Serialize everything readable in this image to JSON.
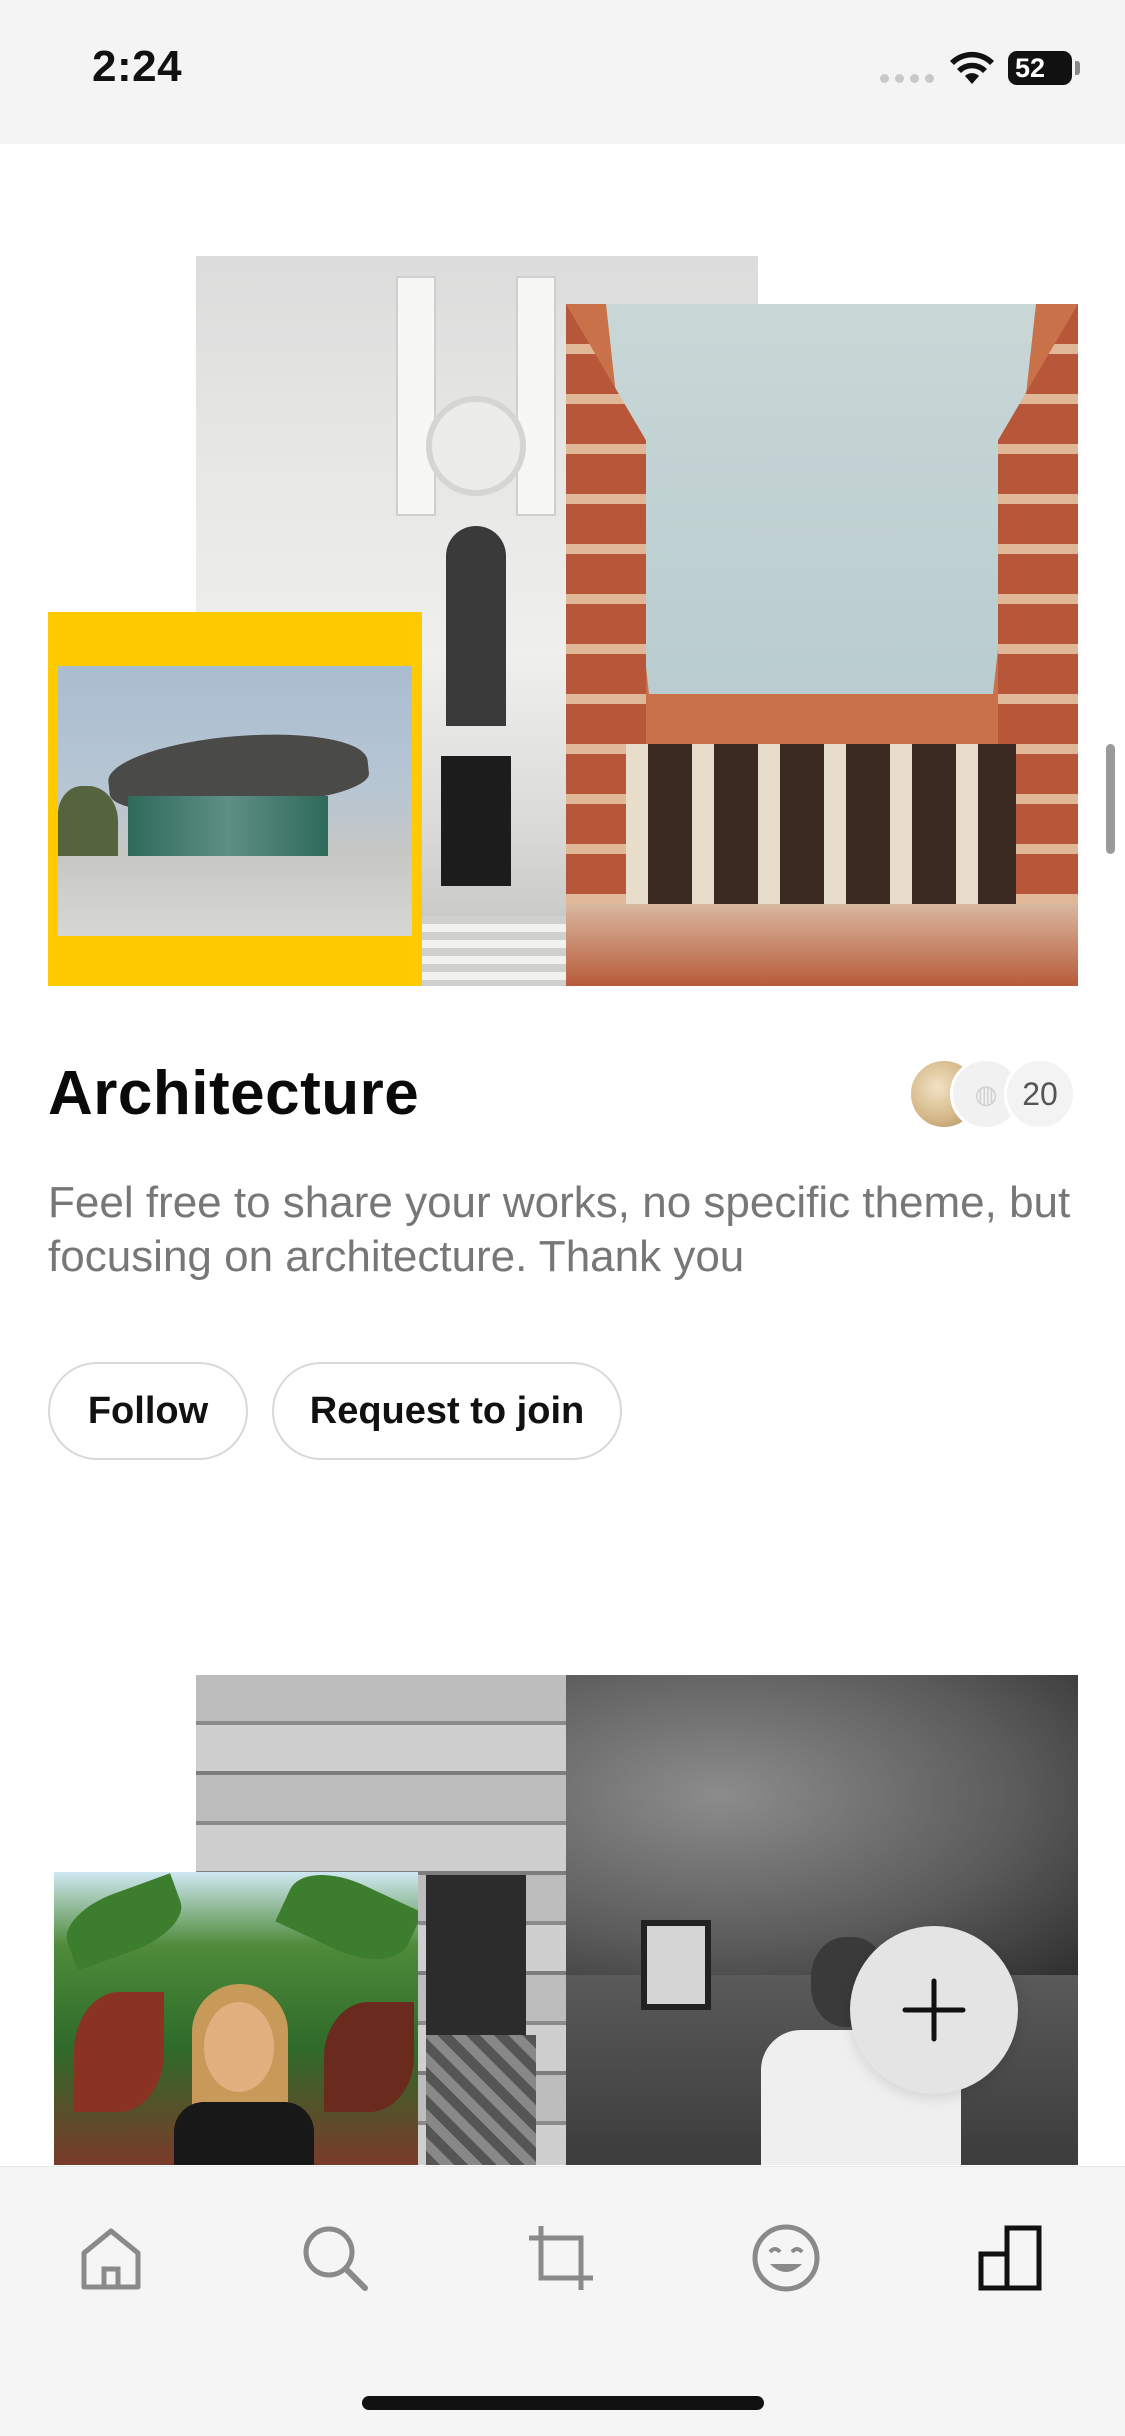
{
  "status_bar": {
    "time": "2:24",
    "battery": "52"
  },
  "group": {
    "title": "Architecture",
    "member_count": "20",
    "description": "Feel free to share your works, no specific theme, but focusing on architecture. Thank you",
    "follow_label": "Follow",
    "join_label": "Request to join"
  },
  "tab_bar": {
    "items": [
      {
        "icon": "home-icon",
        "active": false
      },
      {
        "icon": "search-icon",
        "active": false
      },
      {
        "icon": "crop-icon",
        "active": false
      },
      {
        "icon": "smiley-icon",
        "active": false
      },
      {
        "icon": "groups-icon",
        "active": true
      }
    ]
  },
  "fab": {
    "icon": "plus-icon"
  },
  "colors": {
    "accent_yellow": "#ffcb00",
    "muted_text": "#777777",
    "tab_inactive": "#8a8a8a",
    "tab_active": "#111111"
  }
}
